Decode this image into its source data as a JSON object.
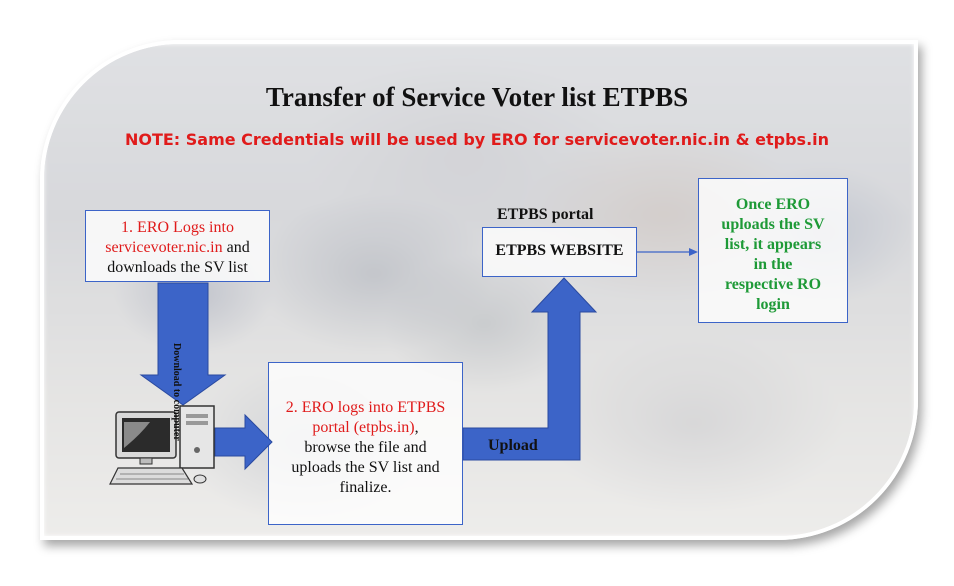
{
  "title": "Transfer of Service Voter list ETPBS",
  "note": "NOTE: Same Credentials will be used by ERO for servicevoter.nic.in & etpbs.in",
  "step1": {
    "line1_red": "1. ERO Logs into",
    "line2_red": "servicevoter.nic.in",
    "line2_rest": " and",
    "line3": "downloads the SV list"
  },
  "download_label": "Download to computer",
  "step2": {
    "line1_red": "2. ERO logs into ETPBS",
    "line2_red": "portal (etpbs.in)",
    "line2_rest": ",",
    "line3": "browse the file and",
    "line4": "uploads the SV list and",
    "line5": "finalize."
  },
  "upload_label": "Upload",
  "portal_label": "ETPBS portal",
  "website_label": "ETPBS WEBSITE",
  "result": {
    "line1": "Once ERO",
    "line2": "uploads the SV",
    "line3": "list, it appears",
    "line4": "in the",
    "line5": "respective RO",
    "line6": "login"
  },
  "colors": {
    "arrow": "#3c64c8",
    "note": "#e01b1b",
    "result": "#1e9a37",
    "box_border": "#3c64c8"
  },
  "icons": [
    "computer-icon"
  ]
}
